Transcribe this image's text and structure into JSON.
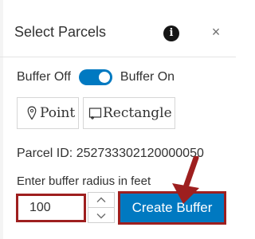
{
  "header": {
    "title": "Select Parcels",
    "info_icon": "info-icon",
    "info_glyph": "i",
    "close_icon": "close-icon",
    "close_glyph": "×"
  },
  "buffer_toggle": {
    "off_label": "Buffer Off",
    "on_label": "Buffer On",
    "state": "on"
  },
  "tools": {
    "point_label": "Point",
    "point_icon": "point-pin-icon",
    "rectangle_label": "Rectangle",
    "rectangle_icon": "rectangle-select-icon"
  },
  "parcel": {
    "id_text": "Parcel ID: 252733302120000050"
  },
  "buffer_radius": {
    "label": "Enter buffer radius in feet",
    "value": "100",
    "stepper_up_icon": "chevron-up-icon",
    "stepper_down_icon": "chevron-down-icon"
  },
  "create_button": {
    "label": "Create Buffer"
  },
  "colors": {
    "accent": "#0079c1",
    "highlight_border": "#9e1f1f",
    "annotation_arrow": "#9e1f1f"
  }
}
